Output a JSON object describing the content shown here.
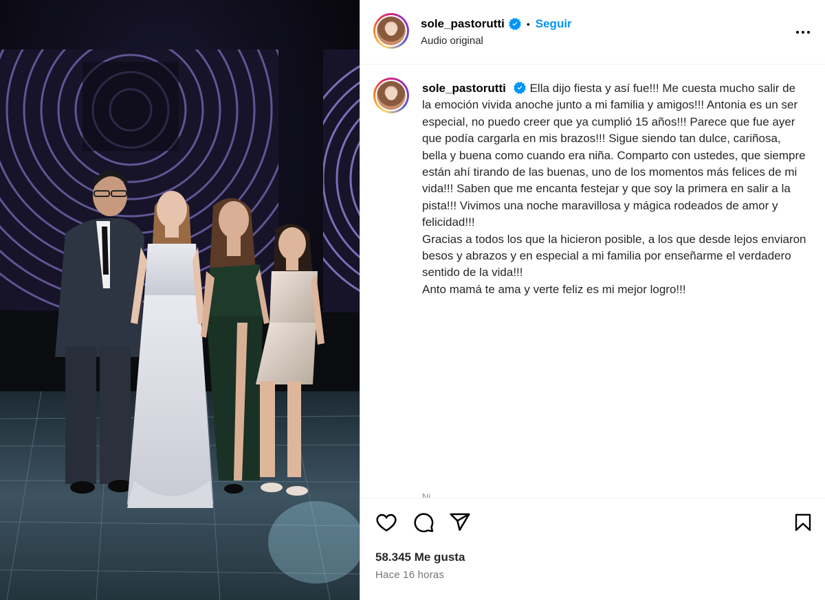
{
  "post": {
    "author": {
      "username": "sole_pastorutti",
      "verified": true,
      "avatar_icon": "profile-photo-avatar"
    },
    "header": {
      "separator": "•",
      "follow_label": "Seguir",
      "audio_label": "Audio original",
      "more_icon": "more-options-icon"
    },
    "caption": {
      "username": "sole_pastorutti",
      "text": "Ella dijo fiesta y así fue!!! Me cuesta mucho salir de la emoción vivida anoche junto a mi familia y amigos!!! Antonia es un ser especial, no puedo creer que ya cumplió 15 años!!! Parece que fue ayer que podía cargarla en mis brazos!!! Sigue siendo tan dulce, cariñosa, bella y buena como cuando era niña. Comparto con ustedes, que siempre están ahí tirando de las buenas, uno de los momentos más felices de mi vida!!! Saben que me encanta festejar y que soy la primera en salir a la pista!!! Vivimos una noche maravillosa y mágica rodeados de amor y felicidad!!!\nGracias a todos los que la hicieron posible, a los que desde lejos enviaron besos y abrazos y en especial a mi familia por enseñarme el verdadero sentido de la vida!!!\nAnto mamá te ama y verte feliz es mi mejor logro!!!",
      "peek_text": "Ni..."
    },
    "actions": {
      "icons": [
        "heart-icon",
        "comment-icon",
        "share-icon",
        "bookmark-icon"
      ],
      "likes_label": "58.345 Me gusta",
      "time_label": "Hace 16 horas"
    },
    "colors": {
      "link_blue": "#0095f6",
      "verified_blue": "#0095f6",
      "text": "#262626",
      "muted": "#737373",
      "divider": "#efefef"
    },
    "media": {
      "kind": "photo",
      "subject_icon": "family-group-photo"
    }
  }
}
